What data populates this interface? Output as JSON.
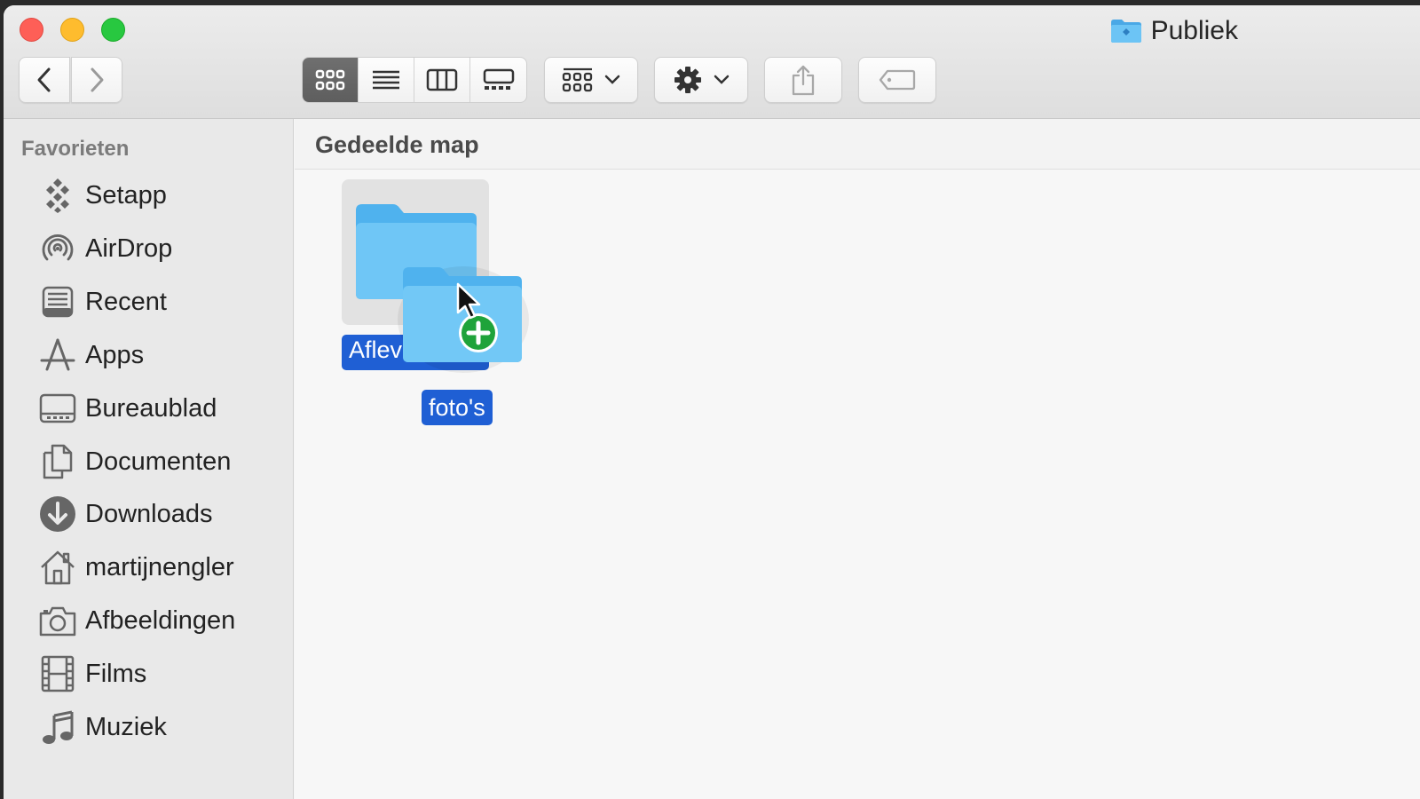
{
  "window": {
    "title": "Publiek"
  },
  "sidebar": {
    "heading": "Favorieten",
    "items": [
      {
        "label": "Setapp",
        "icon": "setapp-icon"
      },
      {
        "label": "AirDrop",
        "icon": "airdrop-icon"
      },
      {
        "label": "Recent",
        "icon": "recent-icon"
      },
      {
        "label": "Apps",
        "icon": "apps-icon"
      },
      {
        "label": "Bureaublad",
        "icon": "desktop-icon"
      },
      {
        "label": "Documenten",
        "icon": "documents-icon"
      },
      {
        "label": "Downloads",
        "icon": "downloads-icon"
      },
      {
        "label": "martijnengler",
        "icon": "home-icon"
      },
      {
        "label": "Afbeeldingen",
        "icon": "camera-icon"
      },
      {
        "label": "Films",
        "icon": "film-icon"
      },
      {
        "label": "Muziek",
        "icon": "music-icon"
      }
    ]
  },
  "main": {
    "path_title": "Gedeelde map",
    "files": [
      {
        "name": "Aflevermap",
        "visible_text": "Aflev"
      },
      {
        "name": "foto's"
      }
    ]
  },
  "colors": {
    "accent": "#1f5fd4",
    "folder": "#5bbcf2",
    "add_badge": "#1fa33a"
  }
}
